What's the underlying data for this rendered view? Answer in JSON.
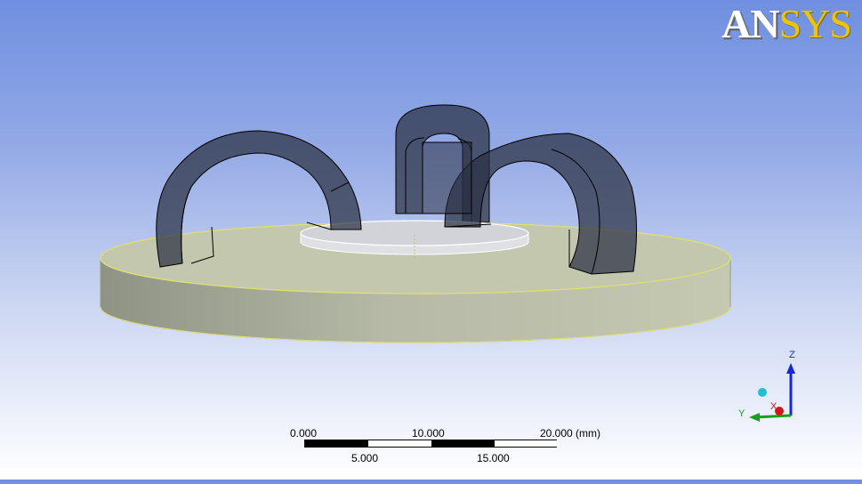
{
  "logo": {
    "text_part1": "AN",
    "text_part2": "SYS"
  },
  "scale_bar": {
    "top_labels": [
      "0.000",
      "10.000",
      "20.000 (mm)"
    ],
    "bottom_labels": [
      "5.000",
      "15.000"
    ]
  },
  "axis_triad": {
    "x_label": "X",
    "y_label": "Y",
    "z_label": "Z"
  },
  "colors": {
    "background_top": "#6f8fe0",
    "background_bottom": "#ffffff",
    "arch_body": "#2a3042",
    "base_disk": "#b6bf9c",
    "logo_accent": "#f0c400"
  }
}
